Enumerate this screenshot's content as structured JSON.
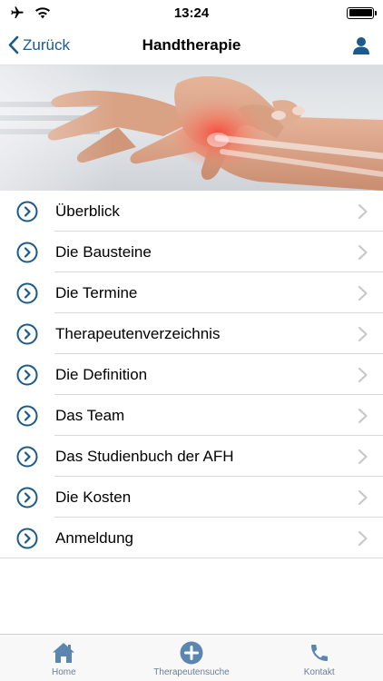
{
  "status_bar": {
    "time": "13:24",
    "icons": [
      "airplane-icon",
      "wifi-icon",
      "battery-icon"
    ]
  },
  "nav": {
    "back_label": "Zurück",
    "title": "Handtherapie",
    "right_icon": "person-icon"
  },
  "colors": {
    "accent": "#1b5a8a",
    "tab_icon": "#5a86b0",
    "tab_label": "#6a7f93",
    "chevron": "#c7c7cc",
    "separator": "#d9d9d9"
  },
  "menu": {
    "items": [
      {
        "label": "Überblick"
      },
      {
        "label": "Die Bausteine"
      },
      {
        "label": "Die Termine"
      },
      {
        "label": "Therapeutenverzeichnis"
      },
      {
        "label": "Die Definition"
      },
      {
        "label": "Das Team"
      },
      {
        "label": "Das Studienbuch der AFH"
      },
      {
        "label": "Die Kosten"
      },
      {
        "label": "Anmeldung"
      }
    ]
  },
  "tabs": [
    {
      "label": "Home",
      "icon": "home-icon"
    },
    {
      "label": "Therapeutensuche",
      "icon": "plus-circle-icon"
    },
    {
      "label": "Kontakt",
      "icon": "phone-icon"
    }
  ]
}
